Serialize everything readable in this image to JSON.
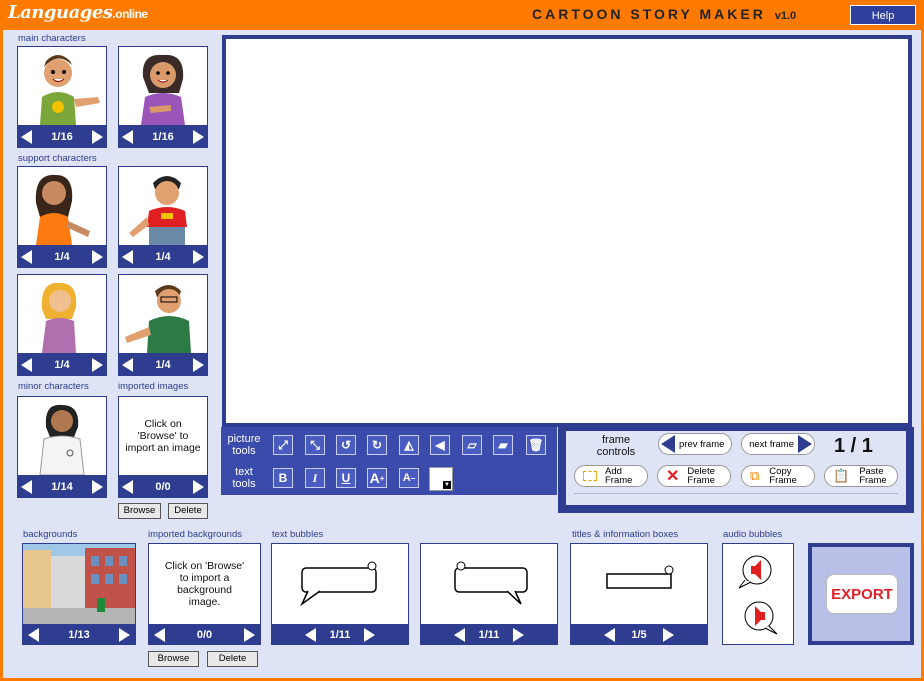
{
  "topbar": {
    "logo_main": "Languages",
    "logo_sub": ".online",
    "title": "CARTOON STORY MAKER",
    "version": "v1.0",
    "help": "Help"
  },
  "left": {
    "main_label": "main characters",
    "support_label": "support characters",
    "minor_label": "minor characters",
    "imported_label": "imported images",
    "main": [
      {
        "count": "1/16"
      },
      {
        "count": "1/16"
      }
    ],
    "support": [
      {
        "count": "1/4"
      },
      {
        "count": "1/4"
      },
      {
        "count": "1/4"
      },
      {
        "count": "1/4"
      }
    ],
    "minor": {
      "count": "1/14"
    },
    "imported": {
      "count": "0/0",
      "hint": "Click on 'Browse' to import an image"
    },
    "browse": "Browse",
    "delete": "Delete"
  },
  "tools": {
    "picture_label": "picture tools",
    "text_label": "text tools",
    "bold": "B",
    "italic": "I",
    "underline": "U",
    "grow": "A",
    "shrink": "A"
  },
  "frames": {
    "label": "frame controls",
    "prev": "prev frame",
    "next": "next frame",
    "counter": "1 / 1",
    "add": "Add Frame",
    "delete": "Delete Frame",
    "copy": "Copy Frame",
    "paste": "Paste Frame"
  },
  "bottom": {
    "backgrounds_label": "backgrounds",
    "backgrounds_count": "1/13",
    "imported_bg_label": "imported backgrounds",
    "imported_bg_hint": "Click on 'Browse' to import a background image.",
    "imported_bg_count": "0/0",
    "text_bubbles_label": "text bubbles",
    "bubble1_count": "1/11",
    "bubble2_count": "1/11",
    "titles_label": "titles & information boxes",
    "titles_count": "1/5",
    "audio_label": "audio bubbles",
    "browse": "Browse",
    "delete": "Delete"
  },
  "export": "EXPORT",
  "colors": {
    "orange": "#ff7a00",
    "navy": "#2e3d8f",
    "panel": "#dfe3f6"
  }
}
